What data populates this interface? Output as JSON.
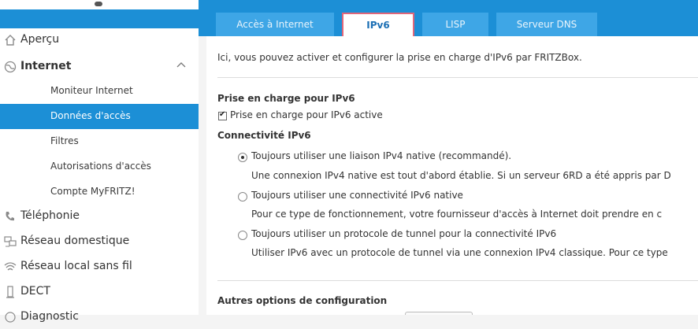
{
  "tabs": [
    {
      "label": "Accès à Internet"
    },
    {
      "label": "IPv6"
    },
    {
      "label": "LISP"
    },
    {
      "label": "Serveur DNS"
    }
  ],
  "sidebar": {
    "items": [
      {
        "label": "Aperçu",
        "icon": "home-icon"
      },
      {
        "label": "Internet",
        "icon": "globe-icon"
      },
      {
        "label": "Téléphonie",
        "icon": "phone-icon"
      },
      {
        "label": "Réseau domestique",
        "icon": "network-icon"
      },
      {
        "label": "Réseau local sans fil",
        "icon": "wifi-icon"
      },
      {
        "label": "DECT",
        "icon": "dect-icon"
      },
      {
        "label": "Diagnostic",
        "icon": "diagnostic-icon"
      }
    ],
    "subitems": [
      {
        "label": "Moniteur Internet"
      },
      {
        "label": "Données d'accès"
      },
      {
        "label": "Filtres"
      },
      {
        "label": "Autorisations d'accès"
      },
      {
        "label": "Compte MyFRITZ!"
      }
    ]
  },
  "content": {
    "intro": "Ici, vous pouvez activer et configurer la prise en charge d'IPv6 par FRITZBox.",
    "support_heading": "Prise en charge pour IPv6",
    "support_checkbox": "Prise en charge pour IPv6 active",
    "connectivity_heading": "Connectivité IPv6",
    "options": [
      {
        "label": "Toujours utiliser une liaison IPv4 native (recommandé).",
        "desc": "Une connexion IPv4 native est tout d'abord établie. Si un serveur 6RD a été appris par D"
      },
      {
        "label": "Toujours utiliser une connectivité IPv6 native",
        "desc": "Pour ce type de fonctionnement, votre fournisseur d'accès à Internet doit prendre en c"
      },
      {
        "label": "Toujours utiliser un protocole de tunnel pour la connectivité IPv6",
        "desc": "Utiliser IPv6 avec un protocole de tunnel via une connexion IPv4 classique. Pour ce type"
      }
    ],
    "other_heading": "Autres options de configuration"
  },
  "colors": {
    "accent": "#1c8fd6",
    "tab": "#3ea6e6",
    "highlight_border": "#e0667a"
  }
}
